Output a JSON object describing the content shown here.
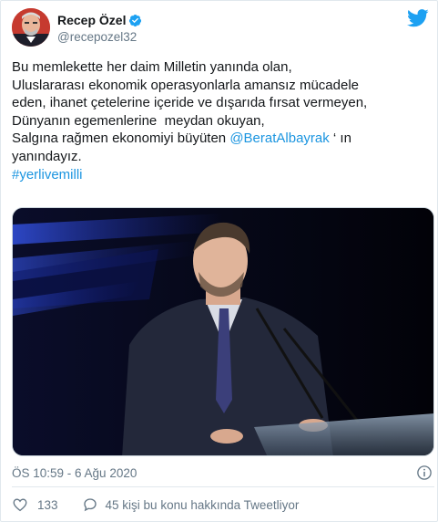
{
  "author": {
    "display_name": "Recep Özel",
    "handle": "@recepozel32",
    "verified_icon": "verified-badge-icon",
    "avatar_icon": "profile-avatar"
  },
  "tweet": {
    "lines": [
      "Bu memlekette her daim Milletin yanında olan,",
      "Uluslararası ekonomik operasyonlarla amansız mücadele",
      "eden, ihanet çetelerine içeride ve dışarıda fırsat vermeyen,",
      "Dünyanın egemenlerine  meydan okuyan,",
      "Salgına rağmen ekonomiyi büyüten ",
      "yanındayız."
    ],
    "mention": "@BeratAlbayrak",
    "after_mention": " ‘ ın",
    "hashtag": "#yerlivemilli"
  },
  "meta": {
    "timestamp": "ÖS 10:59 - 6 Ağu 2020"
  },
  "actions": {
    "like_count": "133",
    "reply_text": "45 kişi bu konu hakkında Tweetliyor"
  },
  "colors": {
    "link": "#1b95e0",
    "twitter_blue": "#1da1f2",
    "secondary_text": "#657786"
  }
}
